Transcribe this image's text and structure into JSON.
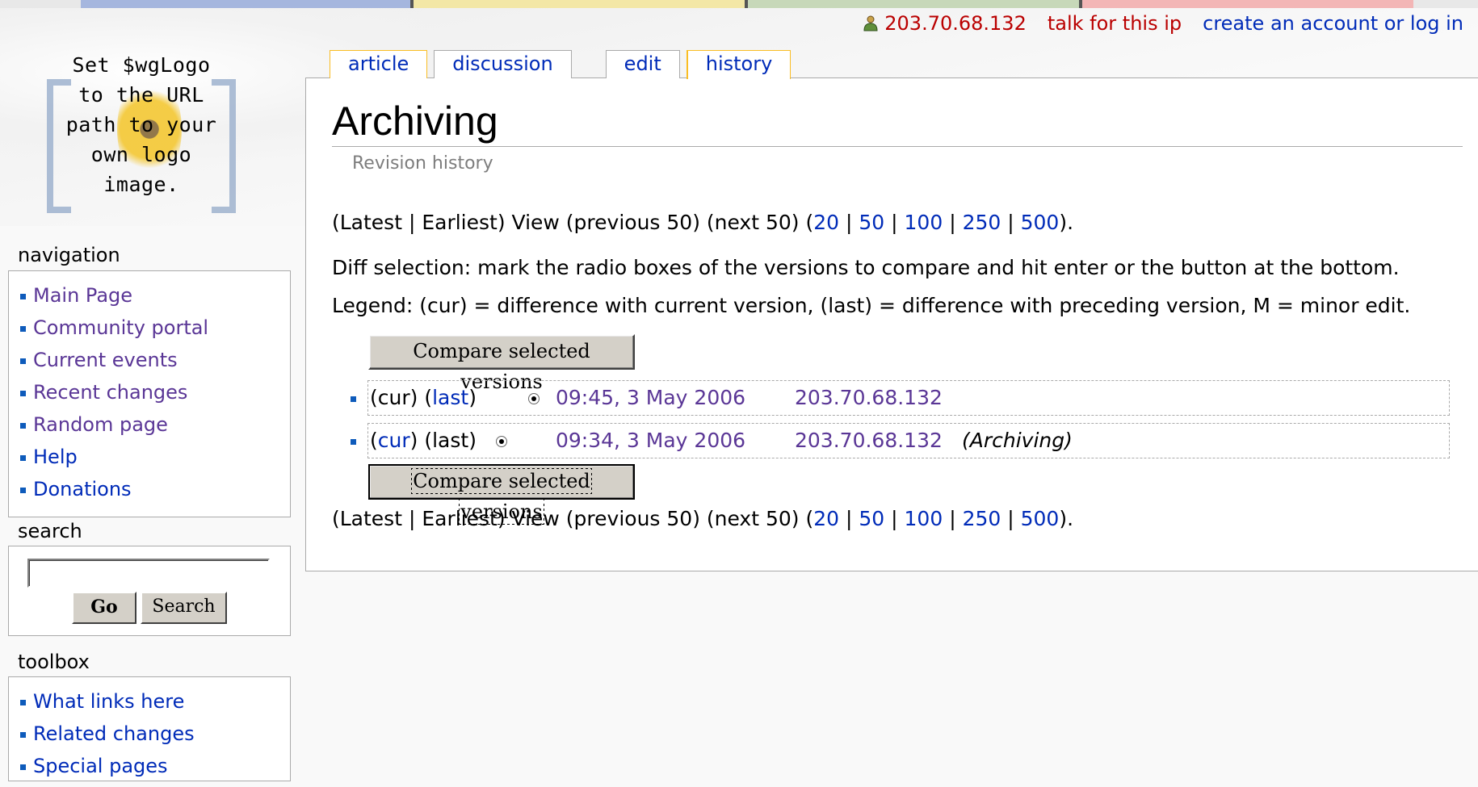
{
  "personal": {
    "user_ip": "203.70.68.132",
    "talk": "talk for this ip",
    "login": "create an account or log in"
  },
  "logo_text": [
    "Set $wgLogo",
    "to the URL",
    "path to your",
    "own logo",
    "image."
  ],
  "tabs": [
    "article",
    "discussion",
    "edit",
    "history"
  ],
  "page": {
    "title": "Archiving",
    "subtitle": "Revision history"
  },
  "paging": {
    "prefix": "(Latest | Earliest) View (previous 50) (next 50) (",
    "limits": [
      "20",
      "50",
      "100",
      "250",
      "500"
    ],
    "suffix": ")."
  },
  "diff_help": "Diff selection: mark the radio boxes of the versions to compare and hit enter or the button at the bottom.",
  "legend": "Legend: (cur) = difference with current version, (last) = difference with preceding version, M = minor edit.",
  "compare_button": "Compare selected versions",
  "revisions": [
    {
      "cur": "(cur)",
      "last_open": "(",
      "last": "last",
      "last_close": ")",
      "date": "09:45, 3 May 2006",
      "user": "203.70.68.132",
      "comment": ""
    },
    {
      "cur_open": "(",
      "cur": "cur",
      "cur_close": ")",
      "last": "(last)",
      "date": "09:34, 3 May 2006",
      "user": "203.70.68.132",
      "comment": "(Archiving)"
    }
  ],
  "sidebar": {
    "navigation_title": "navigation",
    "navigation": [
      "Main Page",
      "Community portal",
      "Current events",
      "Recent changes",
      "Random page",
      "Help",
      "Donations"
    ],
    "search_title": "search",
    "go": "Go",
    "search": "Search",
    "toolbox_title": "toolbox",
    "toolbox": [
      "What links here",
      "Related changes",
      "Special pages"
    ]
  },
  "colors": {
    "link": "#002bb8",
    "visited": "#5a3696",
    "new_link": "#ba0000",
    "tab_selected_border": "#fabd23"
  }
}
